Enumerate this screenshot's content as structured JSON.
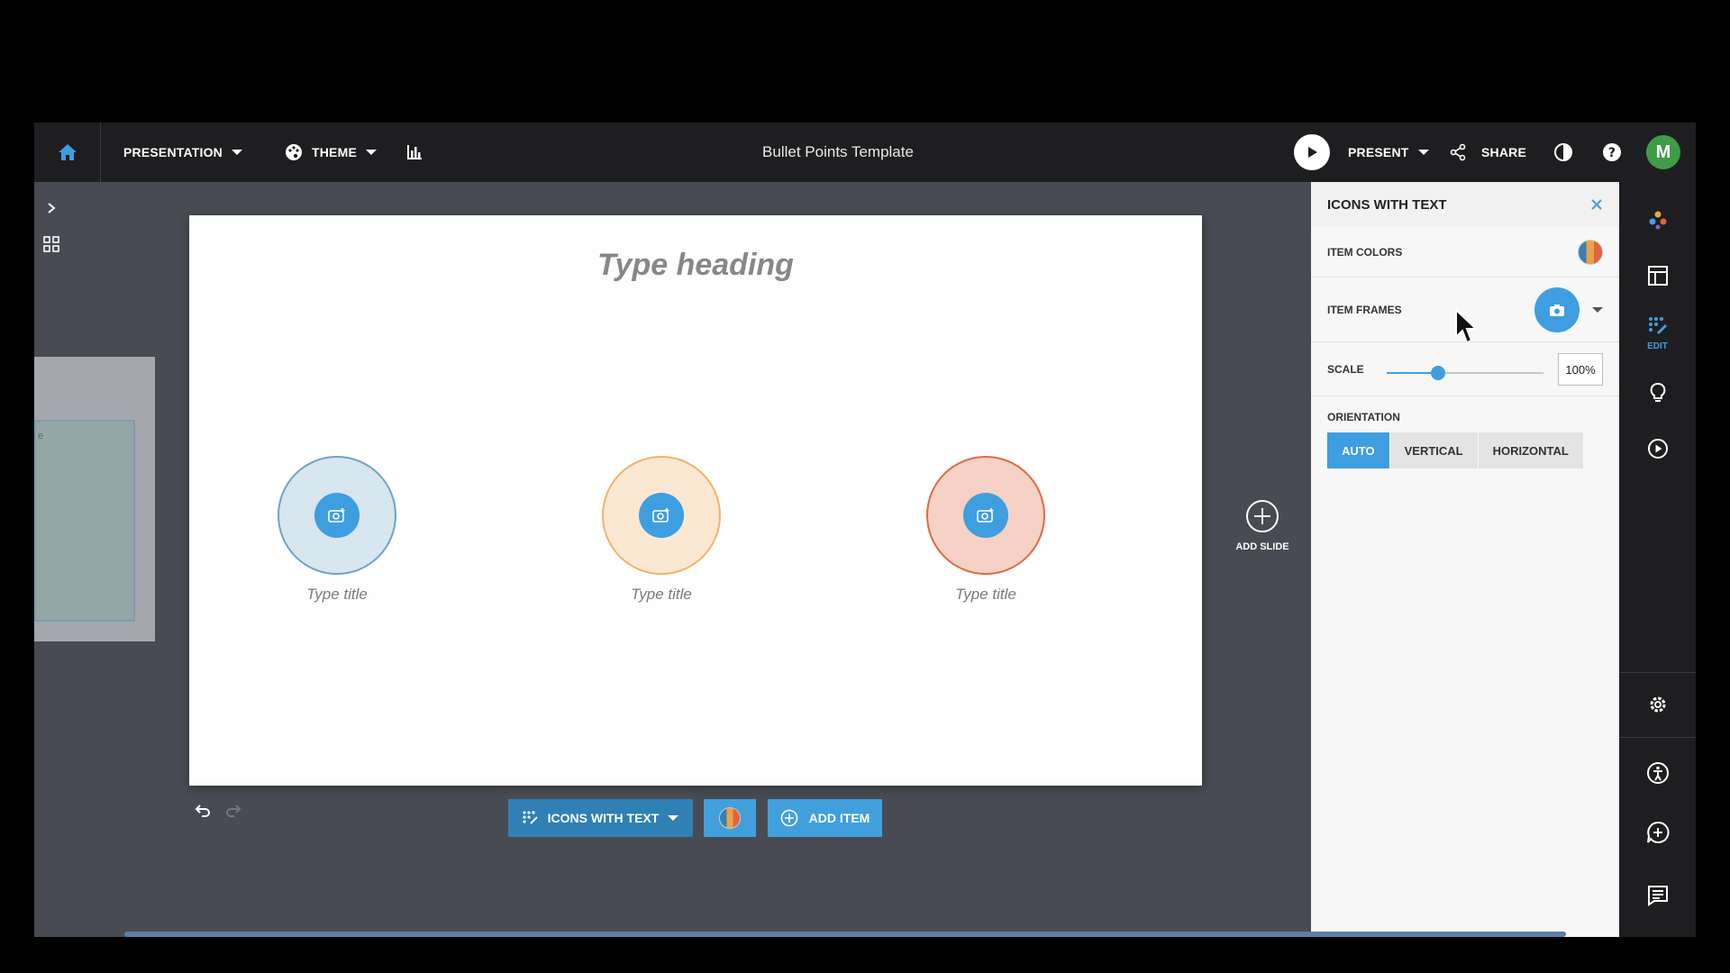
{
  "topbar": {
    "presentation_label": "PRESENTATION",
    "theme_label": "THEME",
    "doc_title": "Bullet Points Template",
    "present_label": "PRESENT",
    "share_label": "SHARE",
    "avatar_initial": "M"
  },
  "slide": {
    "heading": "Type heading",
    "items": [
      {
        "title": "Type title",
        "fill": "#d8e6ef",
        "border": "#6ea3c4"
      },
      {
        "title": "Type title",
        "fill": "#fbe8d2",
        "border": "#f0b468"
      },
      {
        "title": "Type title",
        "fill": "#f5d2c5",
        "border": "#e06a44"
      }
    ]
  },
  "thumbnail": {
    "partial_text": "e"
  },
  "add_slide_label": "ADD SLIDE",
  "toolbar": {
    "layout_label": "ICONS WITH TEXT",
    "add_item_label": "ADD ITEM"
  },
  "panel": {
    "title": "ICONS WITH TEXT",
    "item_colors_label": "ITEM COLORS",
    "item_frames_label": "ITEM FRAMES",
    "scale_label": "SCALE",
    "scale_value": "100%",
    "scale_level": 0.33,
    "orientation_label": "ORIENTATION",
    "orientation_options": [
      "AUTO",
      "VERTICAL",
      "HORIZONTAL"
    ],
    "orientation_selected": "AUTO"
  },
  "rail": {
    "edit_label": "EDIT"
  },
  "colors": {
    "accent": "#3f9ee0",
    "toolbar_button": "#2f80b4",
    "topbar": "#1e1e20",
    "avatar": "#3f9b48"
  }
}
